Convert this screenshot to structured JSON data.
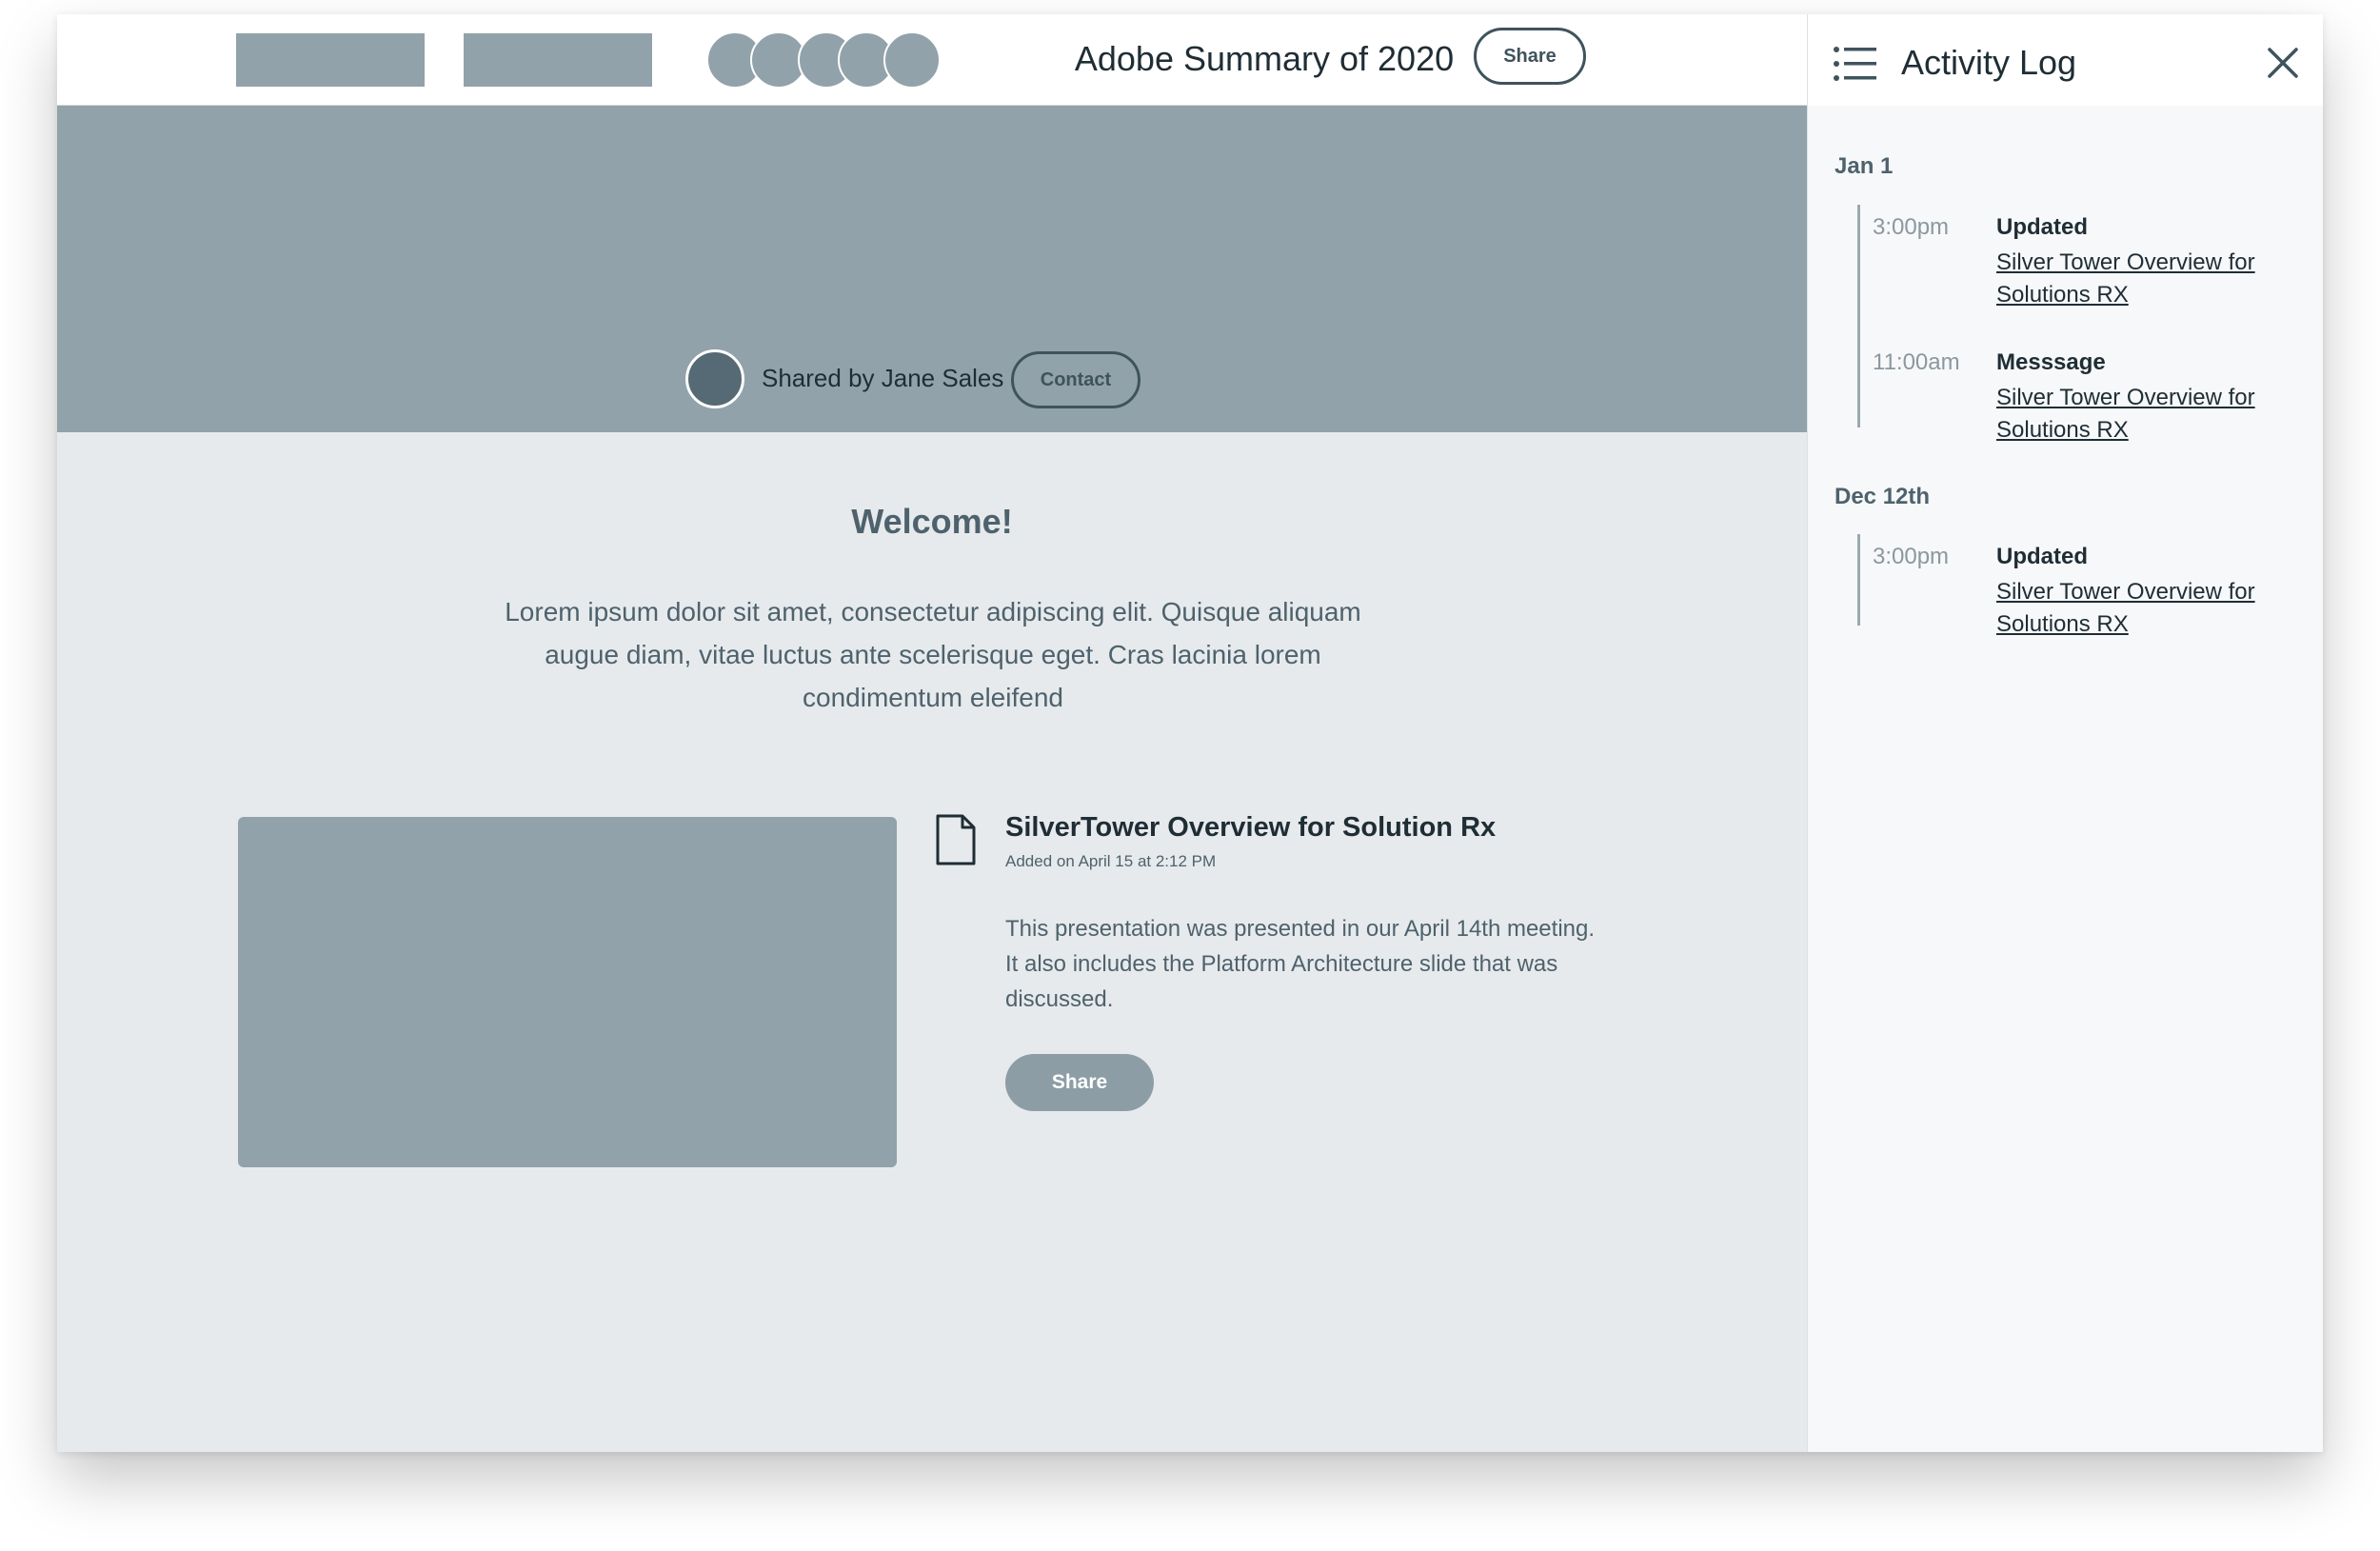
{
  "header": {
    "title": "Adobe Summary of 2020",
    "share_label": "Share"
  },
  "hero": {
    "shared_by": "Shared by Jane Sales",
    "contact_label": "Contact"
  },
  "main": {
    "welcome": "Welcome!",
    "intro": "Lorem ipsum dolor sit amet, consectetur adipiscing elit. Quisque aliquam augue diam, vitae luctus ante scelerisque eget. Cras lacinia lorem condimentum eleifend",
    "document": {
      "icon": "document-icon",
      "title": "SilverTower Overview for Solution Rx",
      "added": "Added on April 15 at 2:12 PM",
      "description": "This presentation was presented in our April 14th meeting. It also includes the Platform Architecture slide that was discussed.",
      "share_label": "Share"
    }
  },
  "activity_log": {
    "title": "Activity Log",
    "menu_icon": "list-icon",
    "close_icon": "close-icon",
    "groups": [
      {
        "date": "Jan 1",
        "entries": [
          {
            "time": "3:00pm",
            "action": "Updated",
            "link": "Silver Tower Overview for Solutions RX"
          },
          {
            "time": "11:00am",
            "action": "Messsage",
            "link": "Silver Tower Overview for Solutions RX"
          }
        ]
      },
      {
        "date": "Dec 12th",
        "entries": [
          {
            "time": "3:00pm",
            "action": "Updated",
            "link": "Silver Tower Overview for Solutions RX"
          }
        ]
      }
    ]
  },
  "colors": {
    "placeholder": "#91a2aa",
    "background": "#e7eaec",
    "text_dark": "#1f2d35",
    "text_muted": "#4e626d"
  }
}
